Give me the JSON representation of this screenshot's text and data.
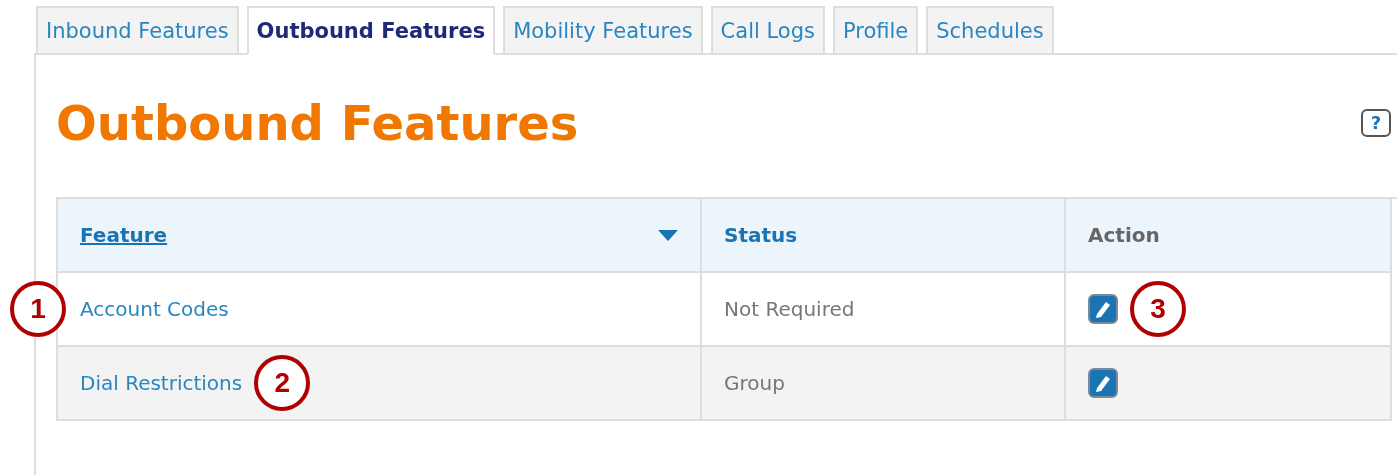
{
  "tabs": [
    {
      "label": "Inbound Features",
      "selected": false
    },
    {
      "label": "Outbound Features",
      "selected": true
    },
    {
      "label": "Mobility Features",
      "selected": false
    },
    {
      "label": "Call Logs",
      "selected": false
    },
    {
      "label": "Profile",
      "selected": false
    },
    {
      "label": "Schedules",
      "selected": false
    }
  ],
  "page_title": "Outbound Features",
  "help_button": "?",
  "table": {
    "columns": [
      {
        "label": "Feature",
        "kind": "sort"
      },
      {
        "label": "Status",
        "kind": "plain"
      },
      {
        "label": "Action",
        "kind": "muted"
      }
    ],
    "rows": [
      {
        "feature": "Account Codes",
        "status": "Not Required",
        "feature_callout": {
          "label": "1",
          "kind": "outside"
        },
        "action_callout": {
          "label": "3",
          "kind": "inline"
        }
      },
      {
        "feature": "Dial Restrictions",
        "status": "Group",
        "feature_callout": {
          "label": "2",
          "kind": "inline"
        }
      }
    ]
  }
}
